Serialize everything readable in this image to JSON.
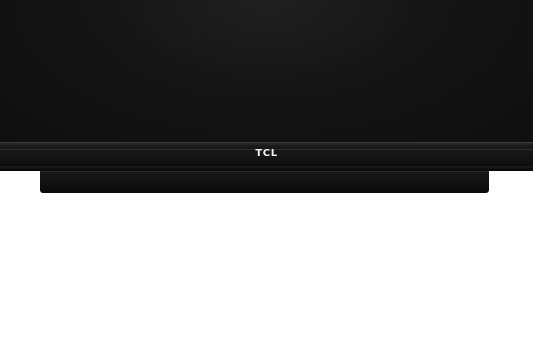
{
  "product": {
    "brand_logo": "TCL"
  },
  "colors": {
    "background": "#ffffff",
    "screen": "#151515",
    "bezel": "#161616",
    "logo": "#f2f2f2"
  }
}
